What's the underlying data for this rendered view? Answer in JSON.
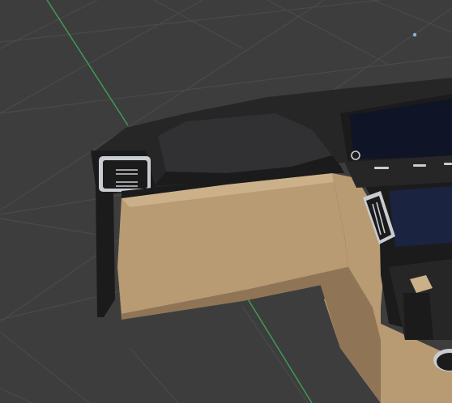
{
  "viewport": {
    "background": "#3d3d3d",
    "grid_color": "#4a4a4a",
    "axis_color": "#3f9b55",
    "cursor_dot_color": "#8fb0d8"
  },
  "model": {
    "colors": {
      "dash_dark": "#1b1b1c",
      "dash_mid": "#262627",
      "dash_light": "#313133",
      "tan": "#b89a73",
      "tan_dark": "#8f7556",
      "tan_light": "#ccb08a",
      "screen": "#0f1426",
      "screen_glow": "#1a2340",
      "chrome": "#c9ccd0"
    }
  }
}
